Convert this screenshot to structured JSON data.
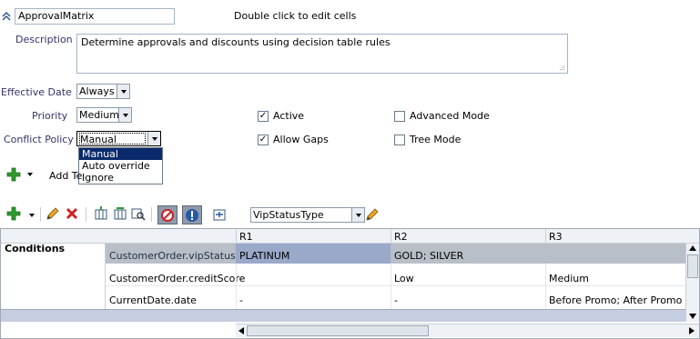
{
  "rule": {
    "name_value": "ApprovalMatrix",
    "hint": "Double click to edit cells",
    "description_label": "Description",
    "description_value": "Determine approvals and discounts using decision table rules",
    "effective_date_label": "Effective Date",
    "effective_date_value": "Always",
    "priority_label": "Priority",
    "priority_value": "Medium",
    "conflict_policy_label": "Conflict Policy",
    "conflict_policy_value": "Manual",
    "conflict_policy_options": [
      "Manual",
      "Auto override",
      "Ignore"
    ],
    "active_label": "Active",
    "active_checked": true,
    "allow_gaps_label": "Allow Gaps",
    "allow_gaps_checked": true,
    "advanced_mode_label": "Advanced Mode",
    "advanced_mode_checked": false,
    "tree_mode_label": "Tree Mode",
    "tree_mode_checked": false,
    "add_test_label": "Add Te"
  },
  "toolbar": {
    "type_select_value": "VipStatusType"
  },
  "table": {
    "columns": [
      "R1",
      "R2",
      "R3"
    ],
    "section_label": "Conditions",
    "rows": [
      {
        "label": "CustomerOrder.vipStatus",
        "cells": [
          "PLATINUM",
          "GOLD; SILVER",
          ""
        ]
      },
      {
        "label": "CustomerOrder.creditScore",
        "cells": [
          "-",
          "Low",
          "Medium"
        ]
      },
      {
        "label": "CurrentDate.date",
        "cells": [
          "-",
          "-",
          "Before Promo; After Promo"
        ]
      }
    ]
  },
  "colors": {
    "label": "#33336b",
    "selection": "#0a2a6b",
    "highlight_cell": "#9aa8c9",
    "highlight_row": "#b9bfc7",
    "band": "#c7cde0"
  }
}
